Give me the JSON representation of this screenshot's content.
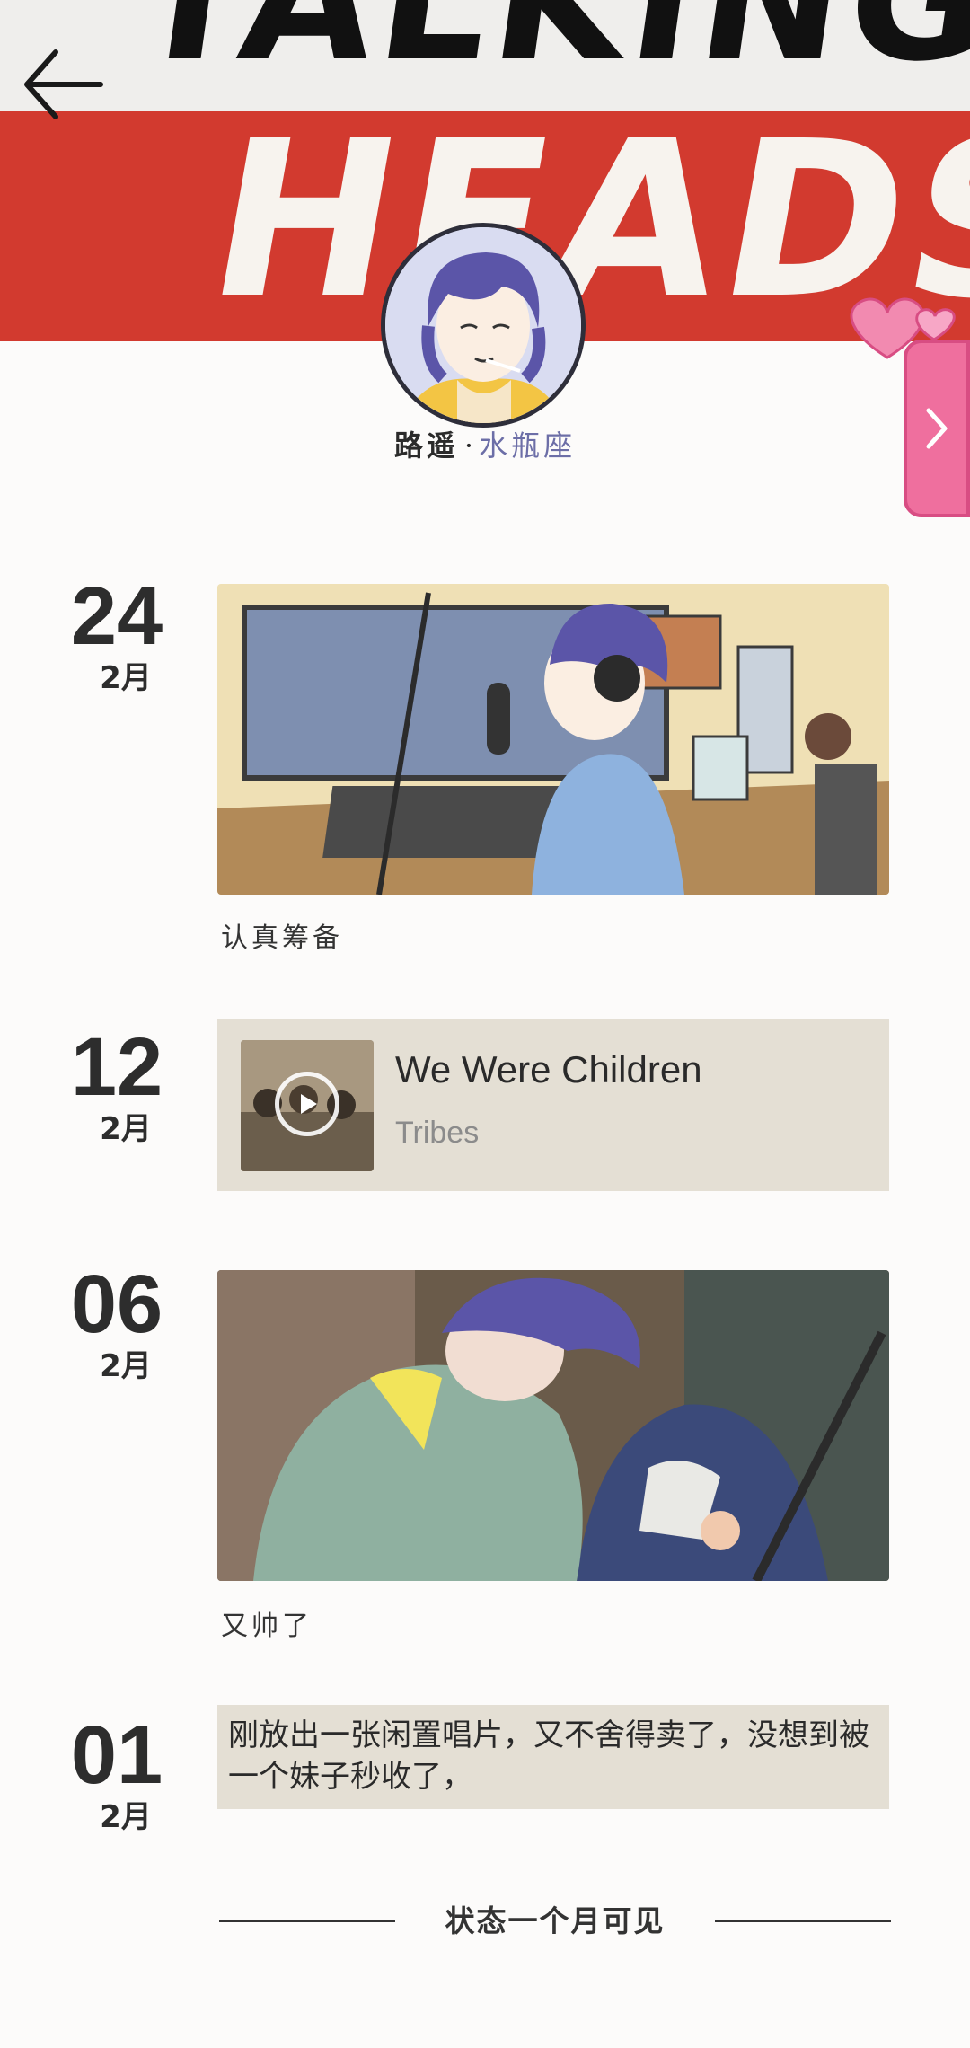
{
  "header": {
    "banner_top_text": "TALKING",
    "banner_bottom_text": "HEADS"
  },
  "profile": {
    "name": "路遥",
    "separator": "·",
    "sign": "水瓶座"
  },
  "colors": {
    "banner_red": "#d23a2f",
    "card_bg": "#e4dfd4",
    "side_tab": "#ef6f9e",
    "sign_purple": "#6c6ea7"
  },
  "icons": {
    "back": "arrow-left-icon",
    "side_tab": "chevron-right-icon",
    "play": "play-icon"
  },
  "entries": [
    {
      "day": "24",
      "month": "2月",
      "caption": "认真筹备"
    },
    {
      "day": "12",
      "month": "2月",
      "music": {
        "title": "We Were Children",
        "artist": "Tribes"
      }
    },
    {
      "day": "06",
      "month": "2月",
      "caption": "又帅了"
    },
    {
      "day": "01",
      "month": "2月",
      "text": "刚放出一张闲置唱片，又不舍得卖了，没想到被一个妹子秒收了，"
    }
  ],
  "footer": {
    "text": "状态一个月可见"
  }
}
